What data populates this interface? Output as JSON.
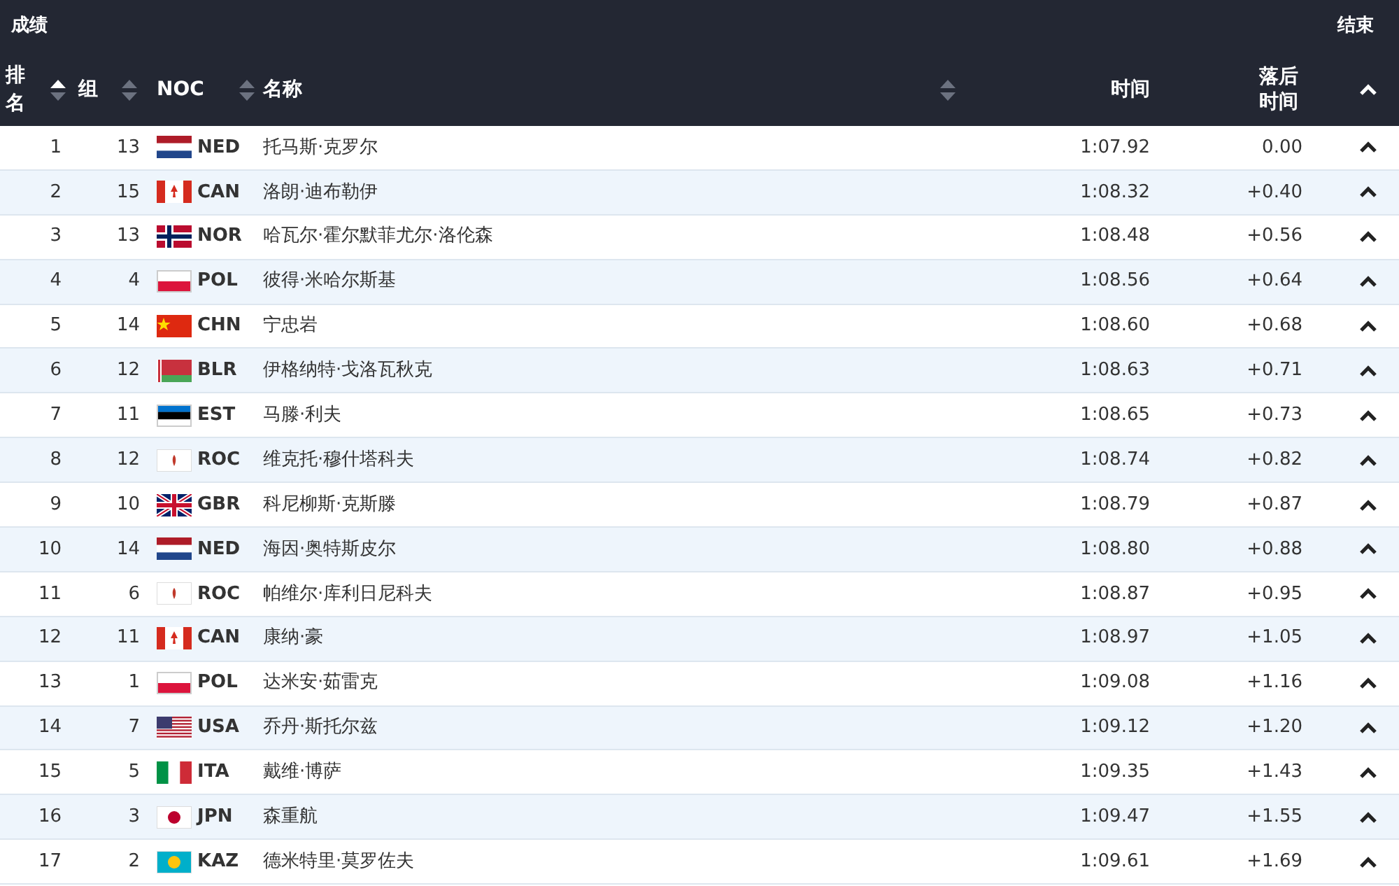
{
  "title": "成绩",
  "status": "结束",
  "columns": [
    {
      "label": "排名",
      "sorted": true
    },
    {
      "label": "组",
      "sorted": false
    },
    {
      "label": "NOC",
      "sorted": false
    },
    {
      "label": "名称",
      "sorted": false
    },
    {
      "label": "时间"
    },
    {
      "label": "落后时间"
    }
  ],
  "rows": [
    {
      "rank": "1",
      "group": "13",
      "noc": "NED",
      "kind": "ned",
      "name": "托马斯·克罗尔",
      "time": "1:07.92",
      "gap": "0.00"
    },
    {
      "rank": "2",
      "group": "15",
      "noc": "CAN",
      "kind": "can",
      "name": "洛朗·迪布勒伊",
      "time": "1:08.32",
      "gap": "+0.40"
    },
    {
      "rank": "3",
      "group": "13",
      "noc": "NOR",
      "kind": "nor",
      "name": "哈瓦尔·霍尔默菲尤尔·洛伦森",
      "time": "1:08.48",
      "gap": "+0.56"
    },
    {
      "rank": "4",
      "group": "4",
      "noc": "POL",
      "kind": "pol",
      "name": "彼得·米哈尔斯基",
      "time": "1:08.56",
      "gap": "+0.64"
    },
    {
      "rank": "5",
      "group": "14",
      "noc": "CHN",
      "kind": "chn",
      "name": "宁忠岩",
      "time": "1:08.60",
      "gap": "+0.68"
    },
    {
      "rank": "6",
      "group": "12",
      "noc": "BLR",
      "kind": "blr",
      "name": "伊格纳特·戈洛瓦秋克",
      "time": "1:08.63",
      "gap": "+0.71"
    },
    {
      "rank": "7",
      "group": "11",
      "noc": "EST",
      "kind": "est",
      "name": "马滕·利夫",
      "time": "1:08.65",
      "gap": "+0.73"
    },
    {
      "rank": "8",
      "group": "12",
      "noc": "ROC",
      "kind": "roc",
      "name": "维克托·穆什塔科夫",
      "time": "1:08.74",
      "gap": "+0.82"
    },
    {
      "rank": "9",
      "group": "10",
      "noc": "GBR",
      "kind": "gbr",
      "name": "科尼柳斯·克斯滕",
      "time": "1:08.79",
      "gap": "+0.87"
    },
    {
      "rank": "10",
      "group": "14",
      "noc": "NED",
      "kind": "ned",
      "name": "海因·奥特斯皮尔",
      "time": "1:08.80",
      "gap": "+0.88"
    },
    {
      "rank": "11",
      "group": "6",
      "noc": "ROC",
      "kind": "roc",
      "name": "帕维尔·库利日尼科夫",
      "time": "1:08.87",
      "gap": "+0.95"
    },
    {
      "rank": "12",
      "group": "11",
      "noc": "CAN",
      "kind": "can",
      "name": "康纳·豪",
      "time": "1:08.97",
      "gap": "+1.05"
    },
    {
      "rank": "13",
      "group": "1",
      "noc": "POL",
      "kind": "pol",
      "name": "达米安·茹雷克",
      "time": "1:09.08",
      "gap": "+1.16"
    },
    {
      "rank": "14",
      "group": "7",
      "noc": "USA",
      "kind": "usa",
      "name": "乔丹·斯托尔兹",
      "time": "1:09.12",
      "gap": "+1.20"
    },
    {
      "rank": "15",
      "group": "5",
      "noc": "ITA",
      "kind": "ita",
      "name": "戴维·博萨",
      "time": "1:09.35",
      "gap": "+1.43"
    },
    {
      "rank": "16",
      "group": "3",
      "noc": "JPN",
      "kind": "jpn",
      "name": "森重航",
      "time": "1:09.47",
      "gap": "+1.55"
    },
    {
      "rank": "17",
      "group": "2",
      "noc": "KAZ",
      "kind": "kaz",
      "name": "德米特里·莫罗佐夫",
      "time": "1:09.61",
      "gap": "+1.69"
    }
  ]
}
